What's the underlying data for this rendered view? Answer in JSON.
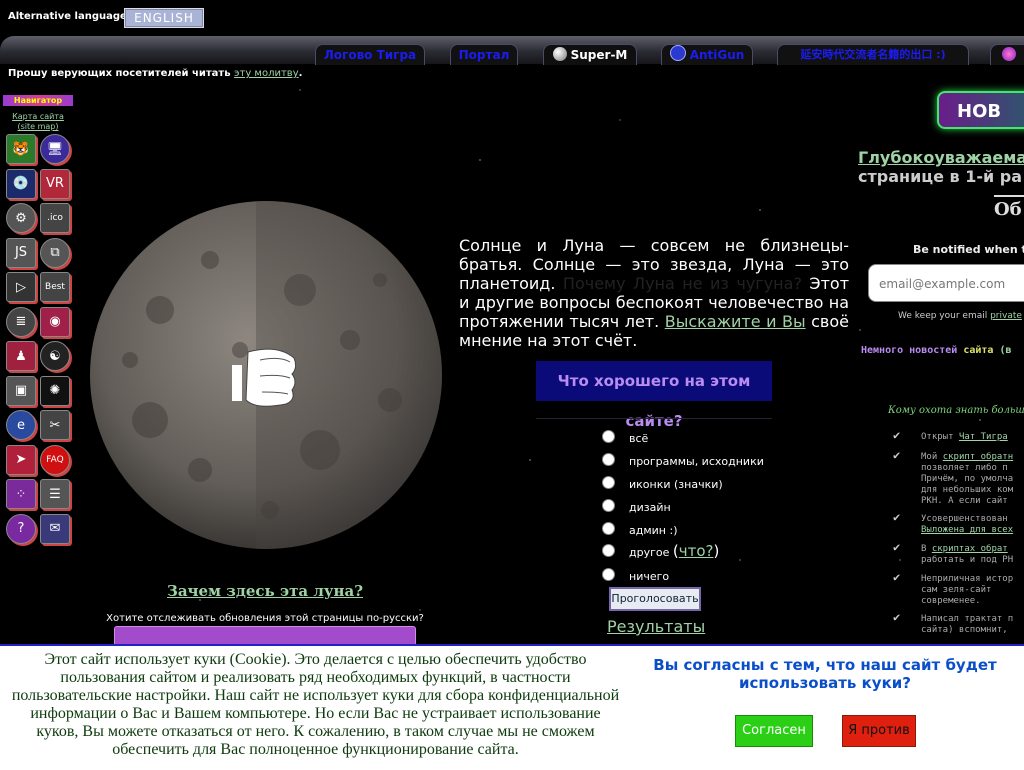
{
  "header": {
    "alt_languages_label": "Alternative languages:",
    "english_button": "ENGLISH",
    "tabs": [
      {
        "label": "Логово Тигра",
        "icon": ""
      },
      {
        "label": "Портал",
        "icon": ""
      },
      {
        "label": "Super-M",
        "icon": "globe-icon"
      },
      {
        "label": "AntiGun",
        "icon": "atom-icon"
      },
      {
        "label": "延安時代交流者名籍的出口 :)",
        "icon": ""
      },
      {
        "label": "",
        "icon": "flower-icon"
      }
    ],
    "prayer_text": "Прошу верующих посетителей читать ",
    "prayer_link": "эту молитву",
    "prayer_end": "."
  },
  "navigator": {
    "title": "Навигатор",
    "sitemap_link_1": "Карта сайта",
    "sitemap_link_2": "(site map)",
    "icons": [
      {
        "name": "tiger-icon",
        "glyph": "🐯",
        "color": "#2a7a2a"
      },
      {
        "name": "monitor-icon",
        "glyph": "🖥",
        "color": "#3a2a9a"
      },
      {
        "name": "disc-icon",
        "glyph": "💿",
        "color": "#1a2a6a"
      },
      {
        "name": "vr-icon",
        "glyph": "VR",
        "color": "#b0283a"
      },
      {
        "name": "tool-icon",
        "glyph": "⚙",
        "color": "#555"
      },
      {
        "name": "ico-icon",
        "glyph": ".ico",
        "color": "#444"
      },
      {
        "name": "js-icon",
        "glyph": "JS",
        "color": "#555"
      },
      {
        "name": "puzzle-icon",
        "glyph": "⧉",
        "color": "#555"
      },
      {
        "name": "play-icon",
        "glyph": "▷",
        "color": "#333"
      },
      {
        "name": "best-icon",
        "glyph": "Best",
        "color": "#444"
      },
      {
        "name": "notes-icon",
        "glyph": "≣",
        "color": "#444"
      },
      {
        "name": "glasses-icon",
        "glyph": "◉",
        "color": "#a0204a"
      },
      {
        "name": "person-icon",
        "glyph": "♟",
        "color": "#a02040"
      },
      {
        "name": "yin-yang-icon",
        "glyph": "☯",
        "color": "#222"
      },
      {
        "name": "stamp-icon",
        "glyph": "▣",
        "color": "#555"
      },
      {
        "name": "star-burst-icon",
        "glyph": "✺",
        "color": "#111"
      },
      {
        "name": "ie-icon",
        "glyph": "e",
        "color": "#2a4aa0"
      },
      {
        "name": "tools-icon",
        "glyph": "✂",
        "color": "#444"
      },
      {
        "name": "cursor-icon",
        "glyph": "➤",
        "color": "#b0203a"
      },
      {
        "name": "faq-icon",
        "glyph": "FAQ",
        "color": "#d01010"
      },
      {
        "name": "dots-icon",
        "glyph": "⁘",
        "color": "#7a2a9a"
      },
      {
        "name": "document-icon",
        "glyph": "☰",
        "color": "#555"
      },
      {
        "name": "question-icon",
        "glyph": "?",
        "color": "#7a2aa0"
      },
      {
        "name": "mail-icon",
        "glyph": "✉",
        "color": "#3a3a7a"
      }
    ]
  },
  "moon": {
    "question_link": "Зачем здесь эта луна?",
    "follow_text": "Хотите отслеживать обновления этой страницы по-русски?",
    "follow_box": ""
  },
  "intro": {
    "part1": "Солнце и Луна — совсем не близнецы-братья. Солнце — это звезда, Луна — это планетоид. ",
    "dark": "Почему Луна не из чугуна?",
    "part2": " Этот и другие вопросы беспокоят человечество на протяжении тысяч лет. ",
    "link": "Выскажите и Вы",
    "part3": " своё мнение на этот счёт."
  },
  "poll": {
    "title": "Что хорошего на этом сайте?",
    "options": [
      "всё",
      "программы, исходники",
      "иконки (значки)",
      "дизайн",
      "админ :)",
      "другое",
      "ничего"
    ],
    "other_link": "что?",
    "vote_button": "Проголосовать",
    "results_link": "Результаты"
  },
  "right": {
    "new_button": "НОВ",
    "greet_line1": "Глубокоуважаема",
    "greet_line2": "странице в 1-й ра",
    "ob": "Об",
    "notify": "Be notified when this",
    "email_placeholder": "email@example.com",
    "private_text": "We keep your email ",
    "private_link": "private",
    "news_a": "Немного новостей",
    "news_b": " сайта",
    "news_c": " (в",
    "who": "Кому охота знать больше но",
    "items": [
      {
        "text": "Открыт ",
        "link": "Чат Тигра",
        "rest": ""
      },
      {
        "text": "Мой ",
        "link": "скрипт обратн",
        "rest": "\nпозволяет либо п\nПричём, по умолча\nдля небольших ком\nРКН. А если сайт"
      },
      {
        "text": "Усовершенствован \n",
        "link": "Выложена для всех",
        "rest": ""
      },
      {
        "text": "В ",
        "link": "скриптах обрат",
        "rest": "\nработать и под РН"
      },
      {
        "text": "Неприличная истор\nсам зеля-сайт\nсовременее.",
        "link": "",
        "rest": ""
      },
      {
        "text": "Написал трактат п\nсайта) вспомнит,",
        "link": "",
        "rest": ""
      }
    ]
  },
  "cookie": {
    "text": "Этот сайт использует куки (Cookie). Это делается с целью обеспечить удобство пользования сайтом и реализовать ряд необходимых функций, в частности пользовательские настройки. Наш сайт не использует куки для сбора конфиденциальной информации о Вас и Вашем компьютере. Но если Вас не устраивает использование куков, Вы можете отказаться от него. К сожалению, в таком случае мы не сможем обеспечить для Вас полноценное функционирование сайта.",
    "question": "Вы согласны с тем, что наш сайт будет использовать куки?",
    "agree": "Согласен",
    "disagree": "Я против"
  }
}
